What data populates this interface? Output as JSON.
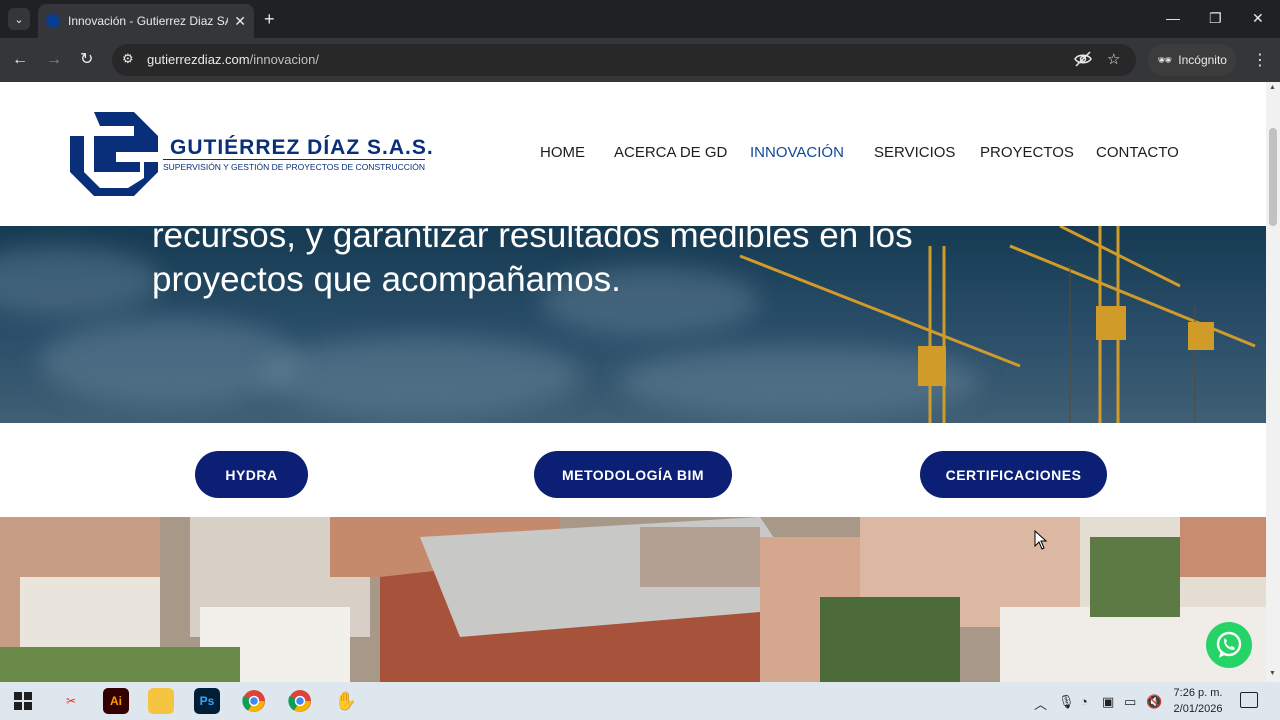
{
  "browser": {
    "tab_title": "Innovación - Gutierrez Diaz SAS",
    "tab_list_icon": "chevron-down-icon",
    "url_domain": "gutierrezdiaz.com",
    "url_path": "/innovacion/",
    "incognito_label": "Incógnito"
  },
  "site": {
    "logo_name": "GUTIÉRREZ DÍAZ S.A.S.",
    "logo_tagline": "SUPERVISIÓN Y GESTIÓN DE PROYECTOS DE CONSTRUCCIÓN",
    "brand_color": "#0a2f7a",
    "nav": [
      {
        "label": "HOME"
      },
      {
        "label": "ACERCA DE GD"
      },
      {
        "label": "INNOVACIÓN",
        "active": true
      },
      {
        "label": "SERVICIOS"
      },
      {
        "label": "PROYECTOS"
      },
      {
        "label": "CONTACTO"
      }
    ],
    "hero_line1": "recursos, y garantizar resultados medibles en los",
    "hero_line2": "proyectos que acompañamos.",
    "buttons": [
      {
        "label": "HYDRA"
      },
      {
        "label": "METODOLOGÍA BIM"
      },
      {
        "label": "CERTIFICACIONES"
      }
    ],
    "button_color": "#0b1f74",
    "whatsapp_color": "#25d366"
  },
  "taskbar": {
    "apps": [
      "windows-start-icon",
      "snipping-tool-icon",
      "illustrator-icon",
      "file-explorer-icon",
      "photoshop-icon",
      "chrome-icon",
      "chrome-icon",
      "other-app-icon"
    ],
    "illustrator_label": "Ai",
    "photoshop_label": "Ps",
    "time": "7:26 p. m.",
    "date": "2/01/2026"
  }
}
